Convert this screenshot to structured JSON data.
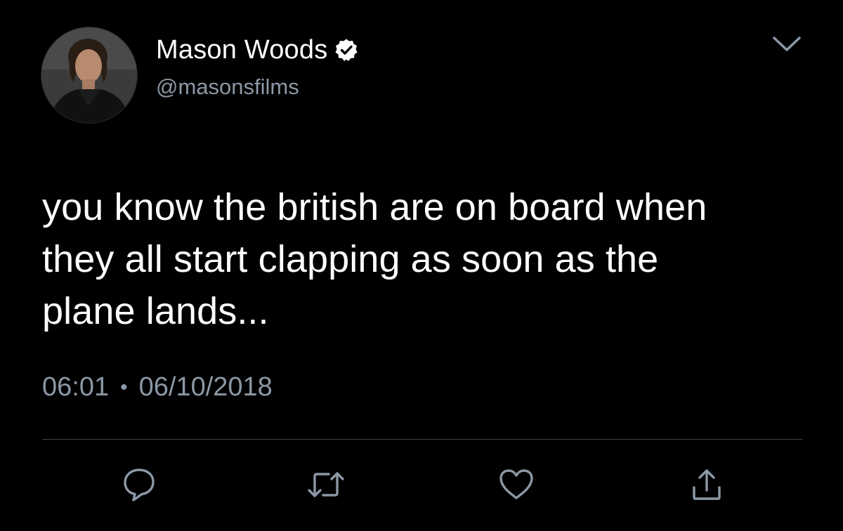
{
  "author": {
    "display_name": "Mason Woods",
    "handle": "@masonsfilms",
    "verified": true
  },
  "tweet": {
    "text": "you know the british are on board when\nthey all start clapping as soon as the\nplane lands...",
    "time": "06:01",
    "separator": "•",
    "date": "06/10/2018"
  },
  "actions": [
    "reply-icon",
    "retweet-icon",
    "like-icon",
    "share-icon"
  ],
  "colors": {
    "background": "#000000",
    "primary_text": "#ffffff",
    "secondary_text": "#8b98a5",
    "divider": "#3d4247"
  }
}
